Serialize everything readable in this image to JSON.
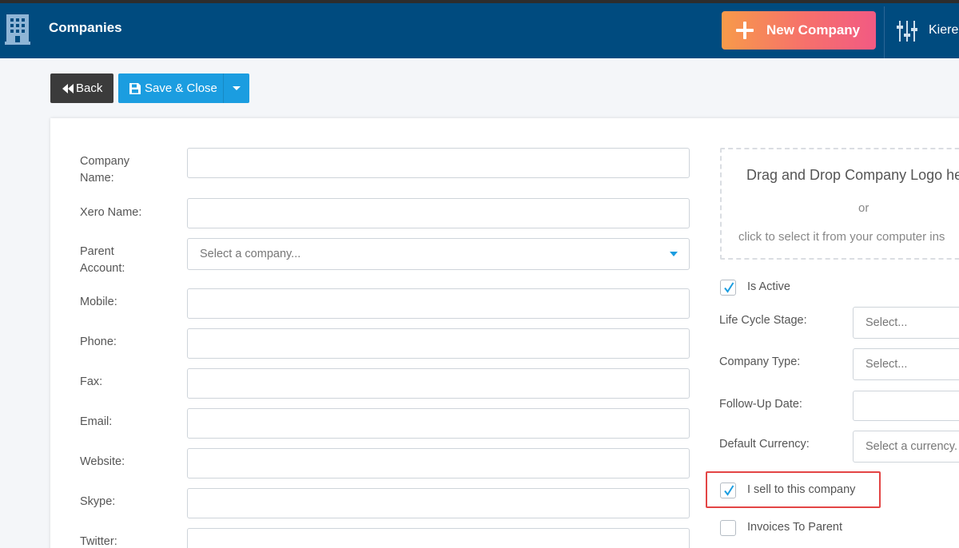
{
  "header": {
    "app_title": "Companies",
    "new_company_label": "New Company",
    "user_name": "Kiere",
    "colors": {
      "bar": "#004b7f",
      "accent_gradient_start": "#f79a4a",
      "accent_gradient_end": "#f25a83"
    }
  },
  "toolbar": {
    "back_label": "Back",
    "save_close_label": "Save & Close"
  },
  "form": {
    "company_name_label_1": "Company",
    "company_name_label_2": "Name:",
    "xero_name_label": "Xero Name:",
    "parent_account_label_1": "Parent",
    "parent_account_label_2": "Account:",
    "parent_account_placeholder": "Select a company...",
    "mobile_label": "Mobile:",
    "phone_label": "Phone:",
    "fax_label": "Fax:",
    "email_label": "Email:",
    "website_label": "Website:",
    "skype_label": "Skype:",
    "twitter_label": "Twitter:"
  },
  "logo_upload": {
    "title": "Drag and Drop Company Logo he",
    "or": "or",
    "subtitle": "click to select it from your computer ins"
  },
  "side": {
    "is_active_label": "Is Active",
    "is_active_checked": true,
    "lifecycle_label": "Life Cycle Stage:",
    "lifecycle_placeholder": "Select...",
    "company_type_label": "Company Type:",
    "company_type_placeholder": "Select...",
    "followup_label": "Follow-Up Date:",
    "currency_label": "Default Currency:",
    "currency_placeholder": "Select a currency.",
    "sell_label": "I sell to this company",
    "sell_checked": true,
    "invoices_label": "Invoices To Parent",
    "invoices_checked": false
  }
}
